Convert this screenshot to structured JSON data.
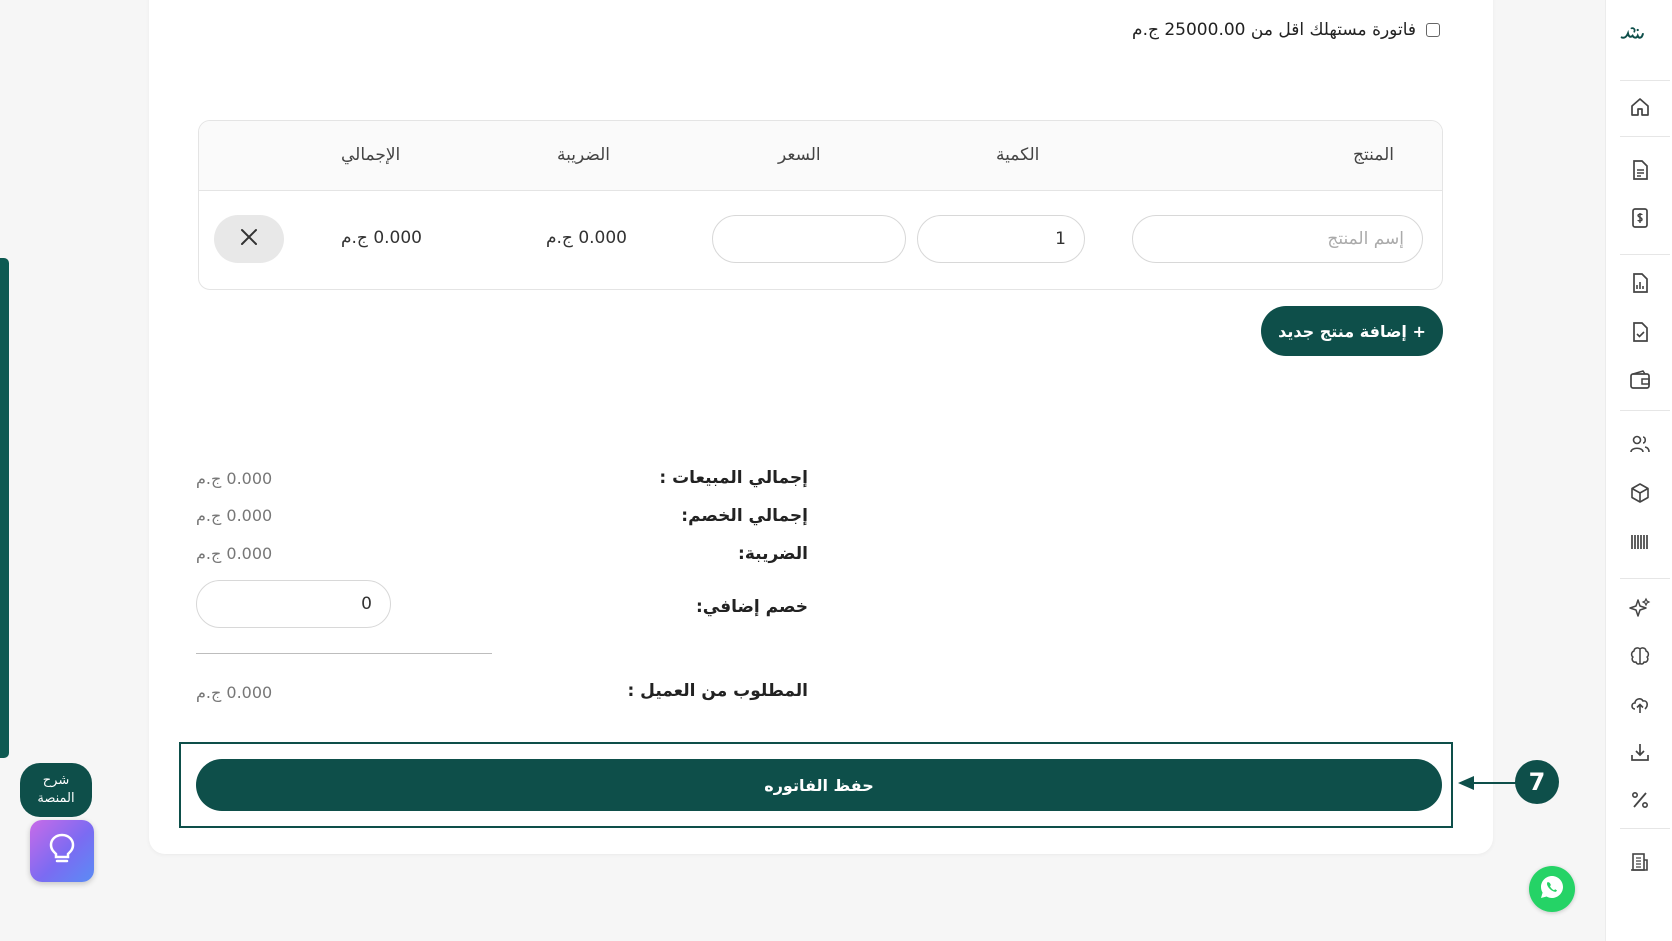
{
  "colors": {
    "brand": "#0e4f4a",
    "whatsapp": "#25d366"
  },
  "consumer_invoice": {
    "label": "فاتورة مستهلك اقل من 25000.00 ج.م",
    "checked": false
  },
  "table": {
    "headers": {
      "product": "المنتج",
      "quantity": "الكمية",
      "price": "السعر",
      "tax": "الضريبة",
      "total": "الإجمالي"
    },
    "row": {
      "product_placeholder": "إسم المنتج",
      "product_value": "",
      "quantity_value": "1",
      "price_value": "",
      "tax": "0.000 ج.م",
      "total": "0.000 ج.م"
    }
  },
  "add_product_label": "+ إضافة منتج جديد",
  "totals": {
    "sales_label": "إجمالي المبيعات :",
    "sales_value": "0.000 ج.م",
    "discount_label": "إجمالي الخصم:",
    "discount_value": "0.000 ج.م",
    "tax_label": "الضريبة:",
    "tax_value": "0.000 ج.م",
    "extra_discount_label": "خصم إضافي:",
    "extra_discount_value": "0",
    "due_label": "المطلوب من العميل :",
    "due_value": "0.000 ج.م"
  },
  "save_label": "حفظ الفاتوره",
  "step_number": "7",
  "help": {
    "line1": "شرح",
    "line2": "المنصة"
  },
  "sidebar_icons": [
    "home-icon",
    "document-icon",
    "invoice-dollar-icon",
    "report-icon",
    "checked-document-icon",
    "wallet-icon",
    "users-icon",
    "package-icon",
    "barcode-icon",
    "sparkle-icon",
    "brain-icon",
    "upload-cloud-icon",
    "download-icon",
    "percent-icon",
    "building-icon"
  ]
}
